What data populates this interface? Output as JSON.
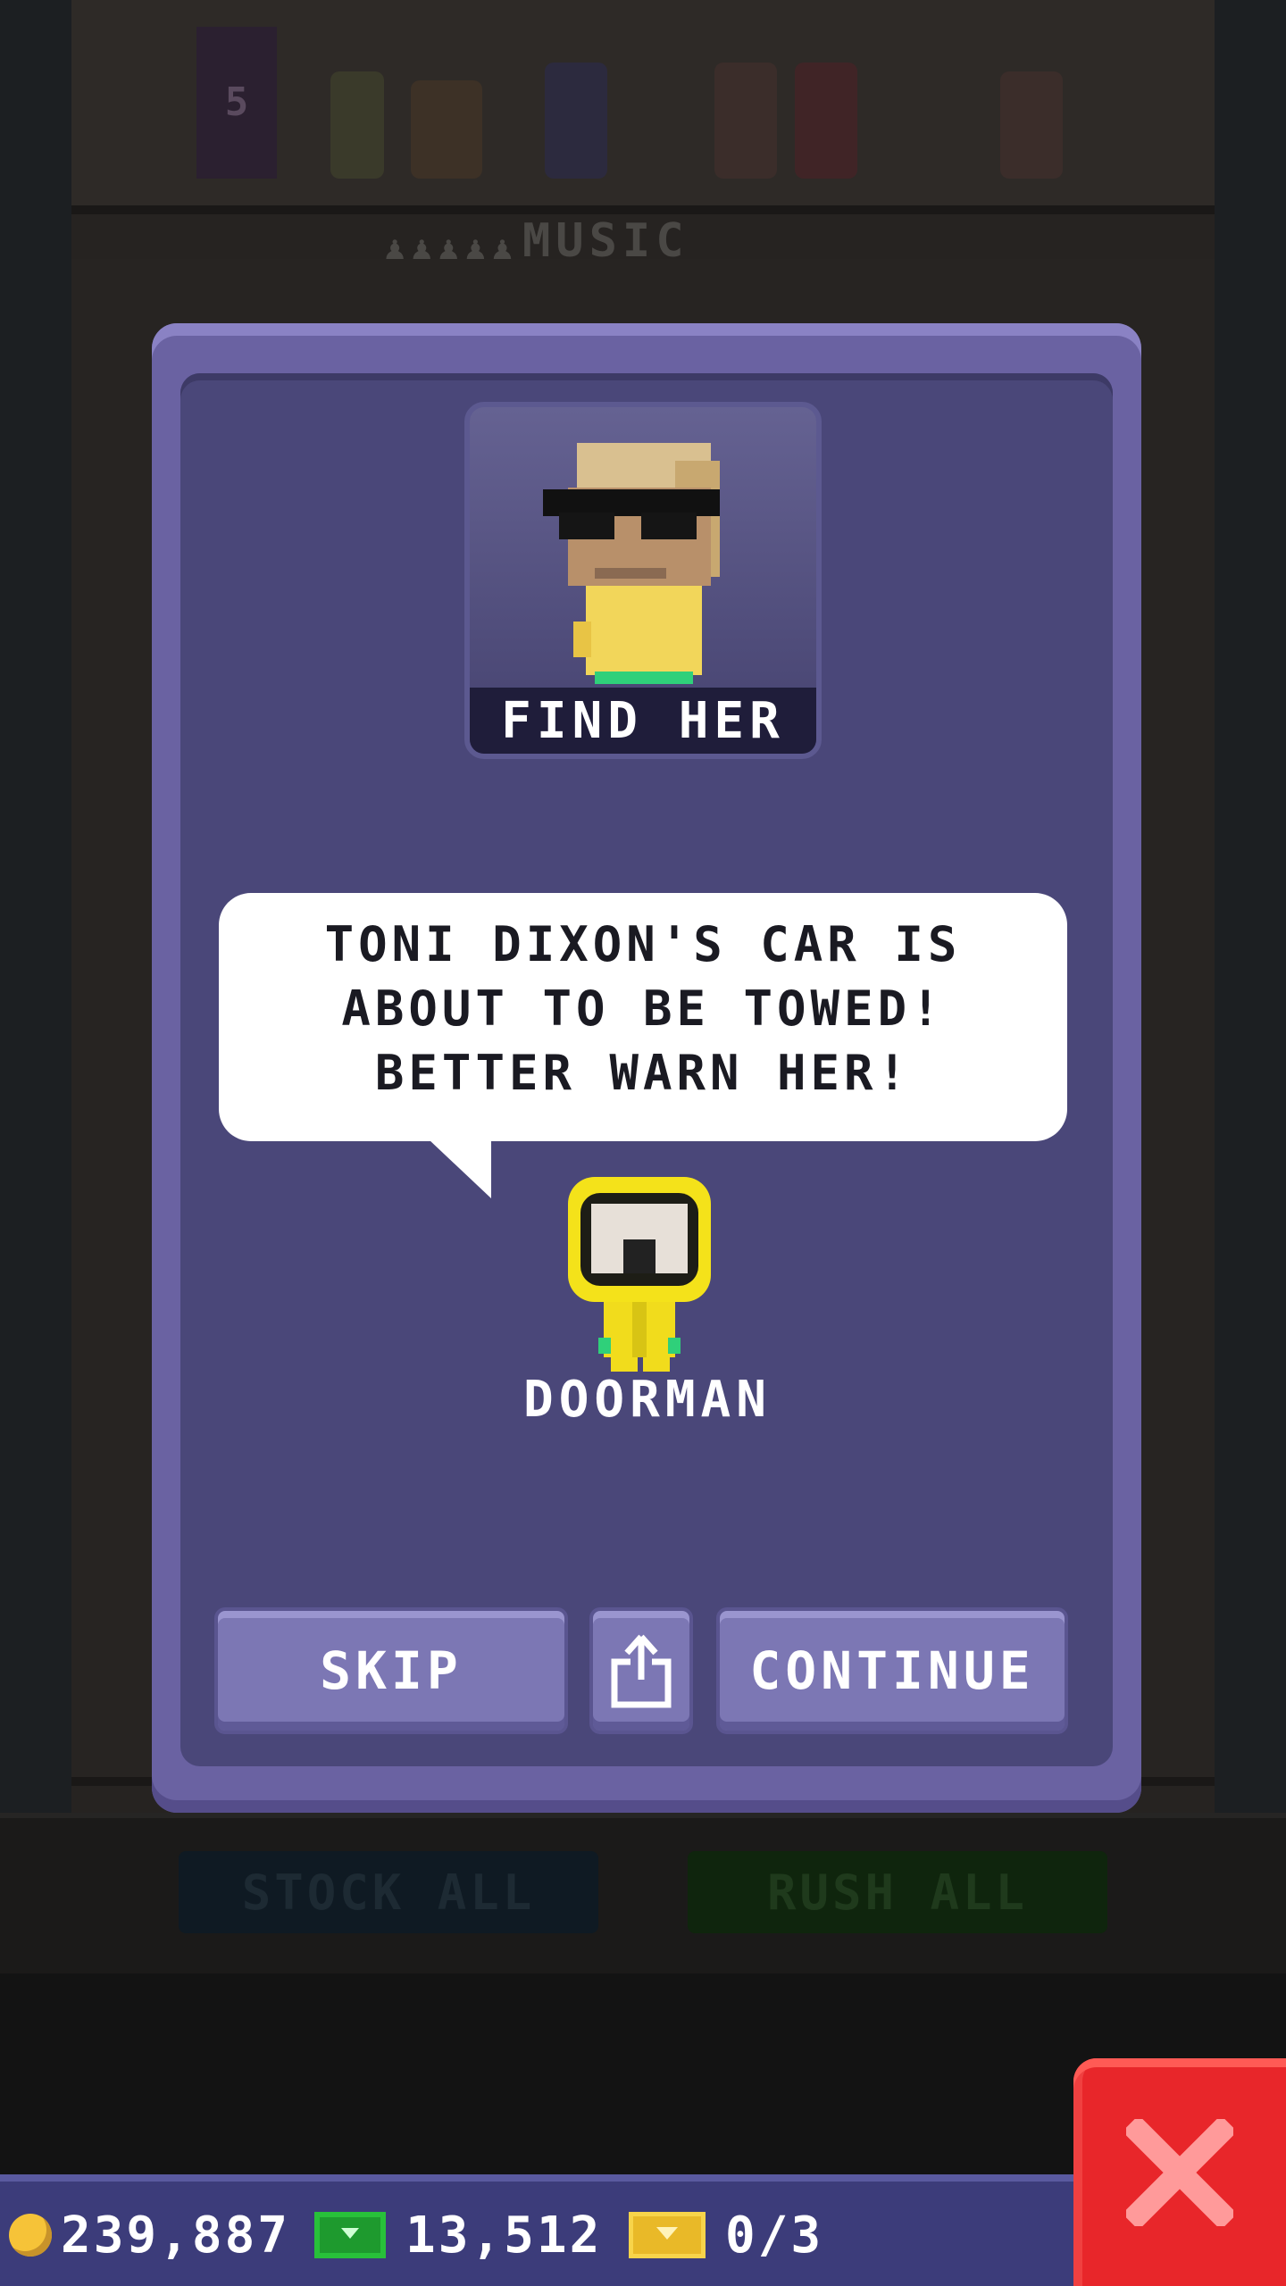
{
  "background": {
    "floor_number": "5",
    "floor_name": "MUSIC",
    "floor_occupancy": "♟♟♟♟♟",
    "stock_all_label": "STOCK ALL",
    "rush_all_label": "RUSH ALL"
  },
  "modal": {
    "portrait_label": "FIND HER",
    "speech_text": "TONI DIXON'S CAR IS ABOUT TO BE TOWED! BETTER WARN HER!",
    "npc_name": "DOORMAN",
    "skip_label": "SKIP",
    "share_icon": "share-icon",
    "continue_label": "CONTINUE"
  },
  "hud": {
    "coins": "239,887",
    "bux": "13,512",
    "tickets": "0/3",
    "close_icon": "close-icon"
  },
  "colors": {
    "modal": "#6a62a2",
    "modal_inner": "#4a4779",
    "button": "#7c77b4",
    "close": "#e8262a",
    "hud": "#3c3c7a"
  }
}
